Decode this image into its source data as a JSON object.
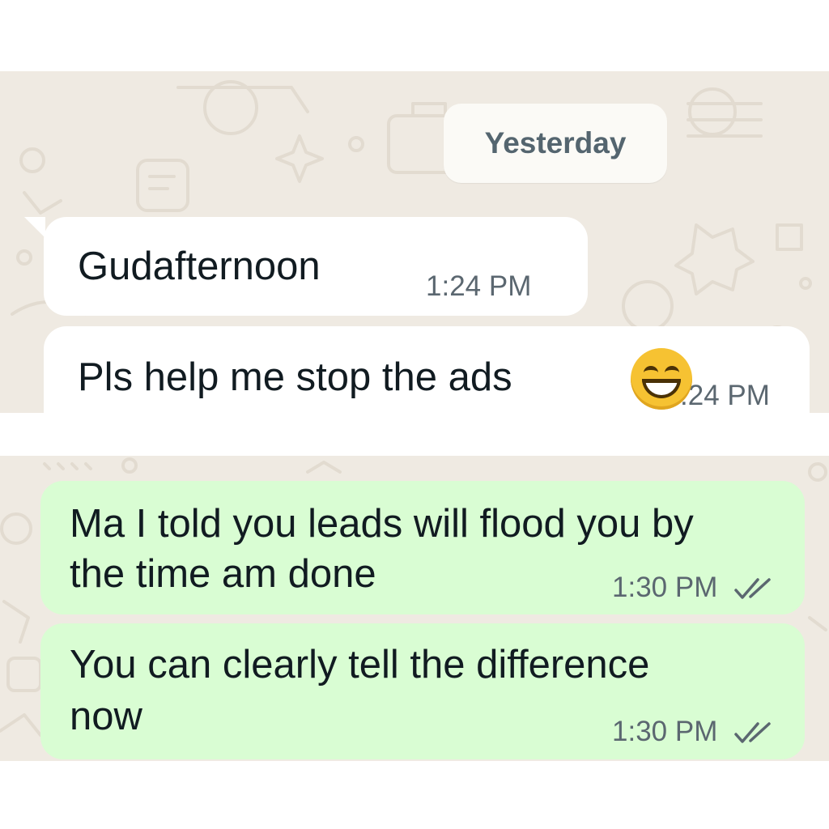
{
  "date_separator": "Yesterday",
  "colors": {
    "chat_background": "#efeae2",
    "incoming_bubble": "#ffffff",
    "outgoing_bubble": "#d9fdd3",
    "read_ticks": "#5b6770"
  },
  "messages": [
    {
      "direction": "incoming",
      "text": "Gudafternoon",
      "time": "1:24 PM"
    },
    {
      "direction": "incoming",
      "text": "Pls help me stop the ads",
      "emoji": "grinning-squinting-face",
      "time": ":24 PM"
    },
    {
      "direction": "outgoing",
      "line1": "Ma I told you leads will flood you by",
      "line2": "the time am done",
      "time": "1:30 PM",
      "status": "double-check-icon"
    },
    {
      "direction": "outgoing",
      "line1": "You can clearly tell the difference",
      "line2": "now",
      "time": "1:30 PM",
      "status": "double-check-icon"
    }
  ]
}
